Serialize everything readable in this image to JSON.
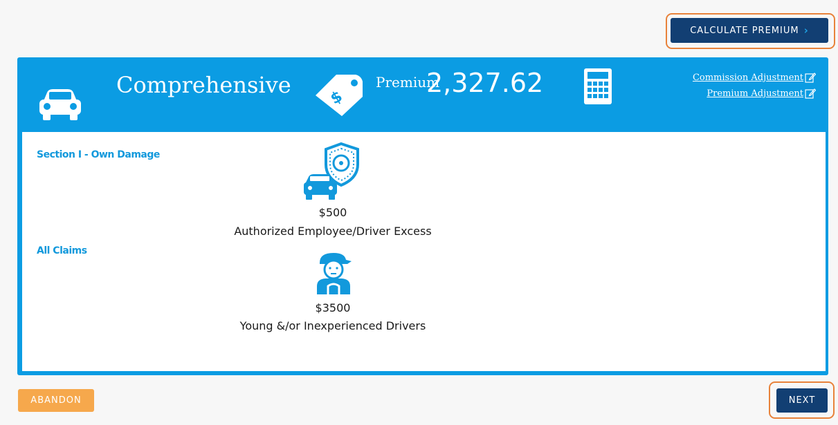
{
  "toolbar": {
    "calculate_label": "CALCULATE PREMIUM",
    "calculate_chevron": "›"
  },
  "coverage": {
    "title": "Comprehensive",
    "premium_label": "Premium",
    "premium_value": "2,327.62",
    "commission_link": "Commission Adjustment",
    "premium_link": "Premium Adjustment",
    "icons": [
      "car-icon",
      "price-tag-icon",
      "calculator-icon",
      "edit-icon"
    ]
  },
  "sections": [
    {
      "heading": "Section I - Own Damage",
      "amount": "$500",
      "label": "Authorized Employee/Driver Excess",
      "icon": "car-shield-icon"
    },
    {
      "heading": "All Claims",
      "amount": "$3500",
      "label": "Young &/or Inexperienced Drivers",
      "icon": "young-driver-icon"
    }
  ],
  "footer": {
    "abandon_label": "ABANDON",
    "next_label": "NEXT"
  },
  "colors": {
    "accent_blue": "#0b9ce3",
    "navy": "#123f73",
    "orange_button": "#f6a84c",
    "highlight": "#e8823a"
  }
}
